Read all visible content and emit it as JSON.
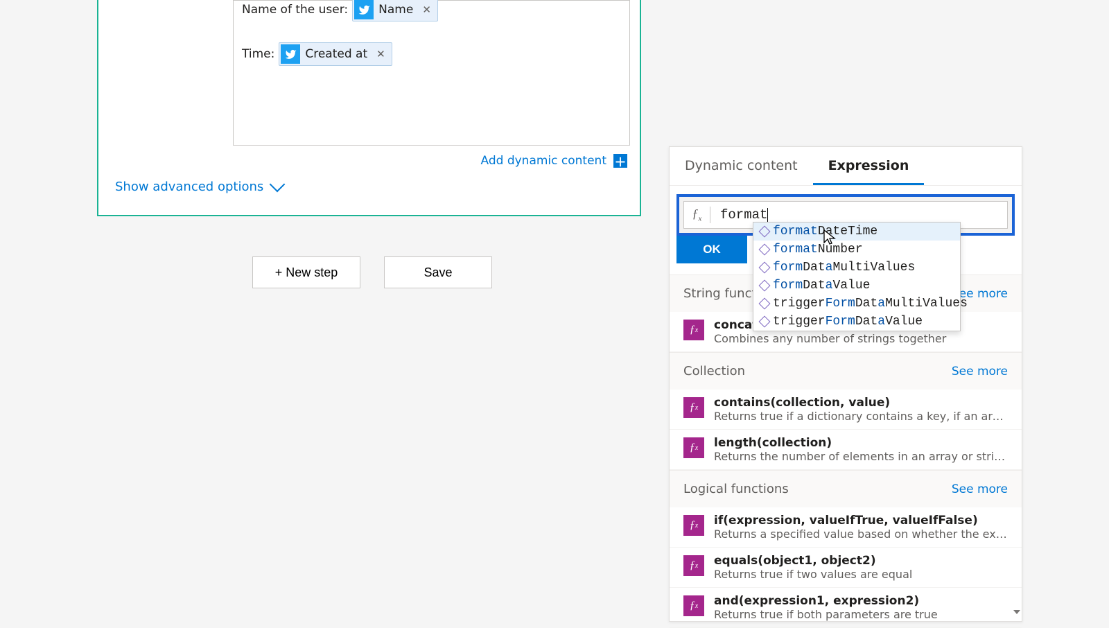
{
  "card": {
    "fields": [
      {
        "label": "Name of the user:",
        "token": "Name"
      },
      {
        "label": "Time:",
        "token": "Created at"
      }
    ],
    "addDynamic": "Add dynamic content",
    "showAdvanced": "Show advanced options"
  },
  "buttons": {
    "newStep": "+ New step",
    "save": "Save"
  },
  "panel": {
    "tabs": {
      "dynamic": "Dynamic content",
      "expression": "Expression"
    },
    "fxLabel": "fx",
    "input": "format",
    "ok": "OK",
    "seeMore": "See more",
    "categories": [
      {
        "name": "String functions",
        "funcs": [
          {
            "sig": "concat(text_1, text_2?, ...)",
            "desc": "Combines any number of strings together"
          }
        ]
      },
      {
        "name": "Collection",
        "funcs": [
          {
            "sig": "contains(collection, value)",
            "desc": "Returns true if a dictionary contains a key, if an array cont..."
          },
          {
            "sig": "length(collection)",
            "desc": "Returns the number of elements in an array or string"
          }
        ]
      },
      {
        "name": "Logical functions",
        "funcs": [
          {
            "sig": "if(expression, valueIfTrue, valueIfFalse)",
            "desc": "Returns a specified value based on whether the expressio..."
          },
          {
            "sig": "equals(object1, object2)",
            "desc": "Returns true if two values are equal"
          },
          {
            "sig": "and(expression1, expression2)",
            "desc": "Returns true if both parameters are true"
          }
        ]
      }
    ]
  },
  "ac": [
    {
      "hl": "format",
      "rest": "DateTime",
      "sel": true
    },
    {
      "hl": "format",
      "rest": "Number",
      "sel": false
    },
    {
      "pre": "",
      "hl1": "form",
      "mid": "Dat",
      "hl2": "a",
      "rest": "MultiValues"
    },
    {
      "pre": "",
      "hl1": "form",
      "mid": "Dat",
      "hl2": "a",
      "rest": "Value"
    },
    {
      "pre": "trigger",
      "hl1": "Form",
      "mid": "Dat",
      "hl2": "a",
      "rest": "MultiValues"
    },
    {
      "pre": "trigger",
      "hl1": "Form",
      "mid": "Dat",
      "hl2": "a",
      "rest": "Value"
    }
  ]
}
